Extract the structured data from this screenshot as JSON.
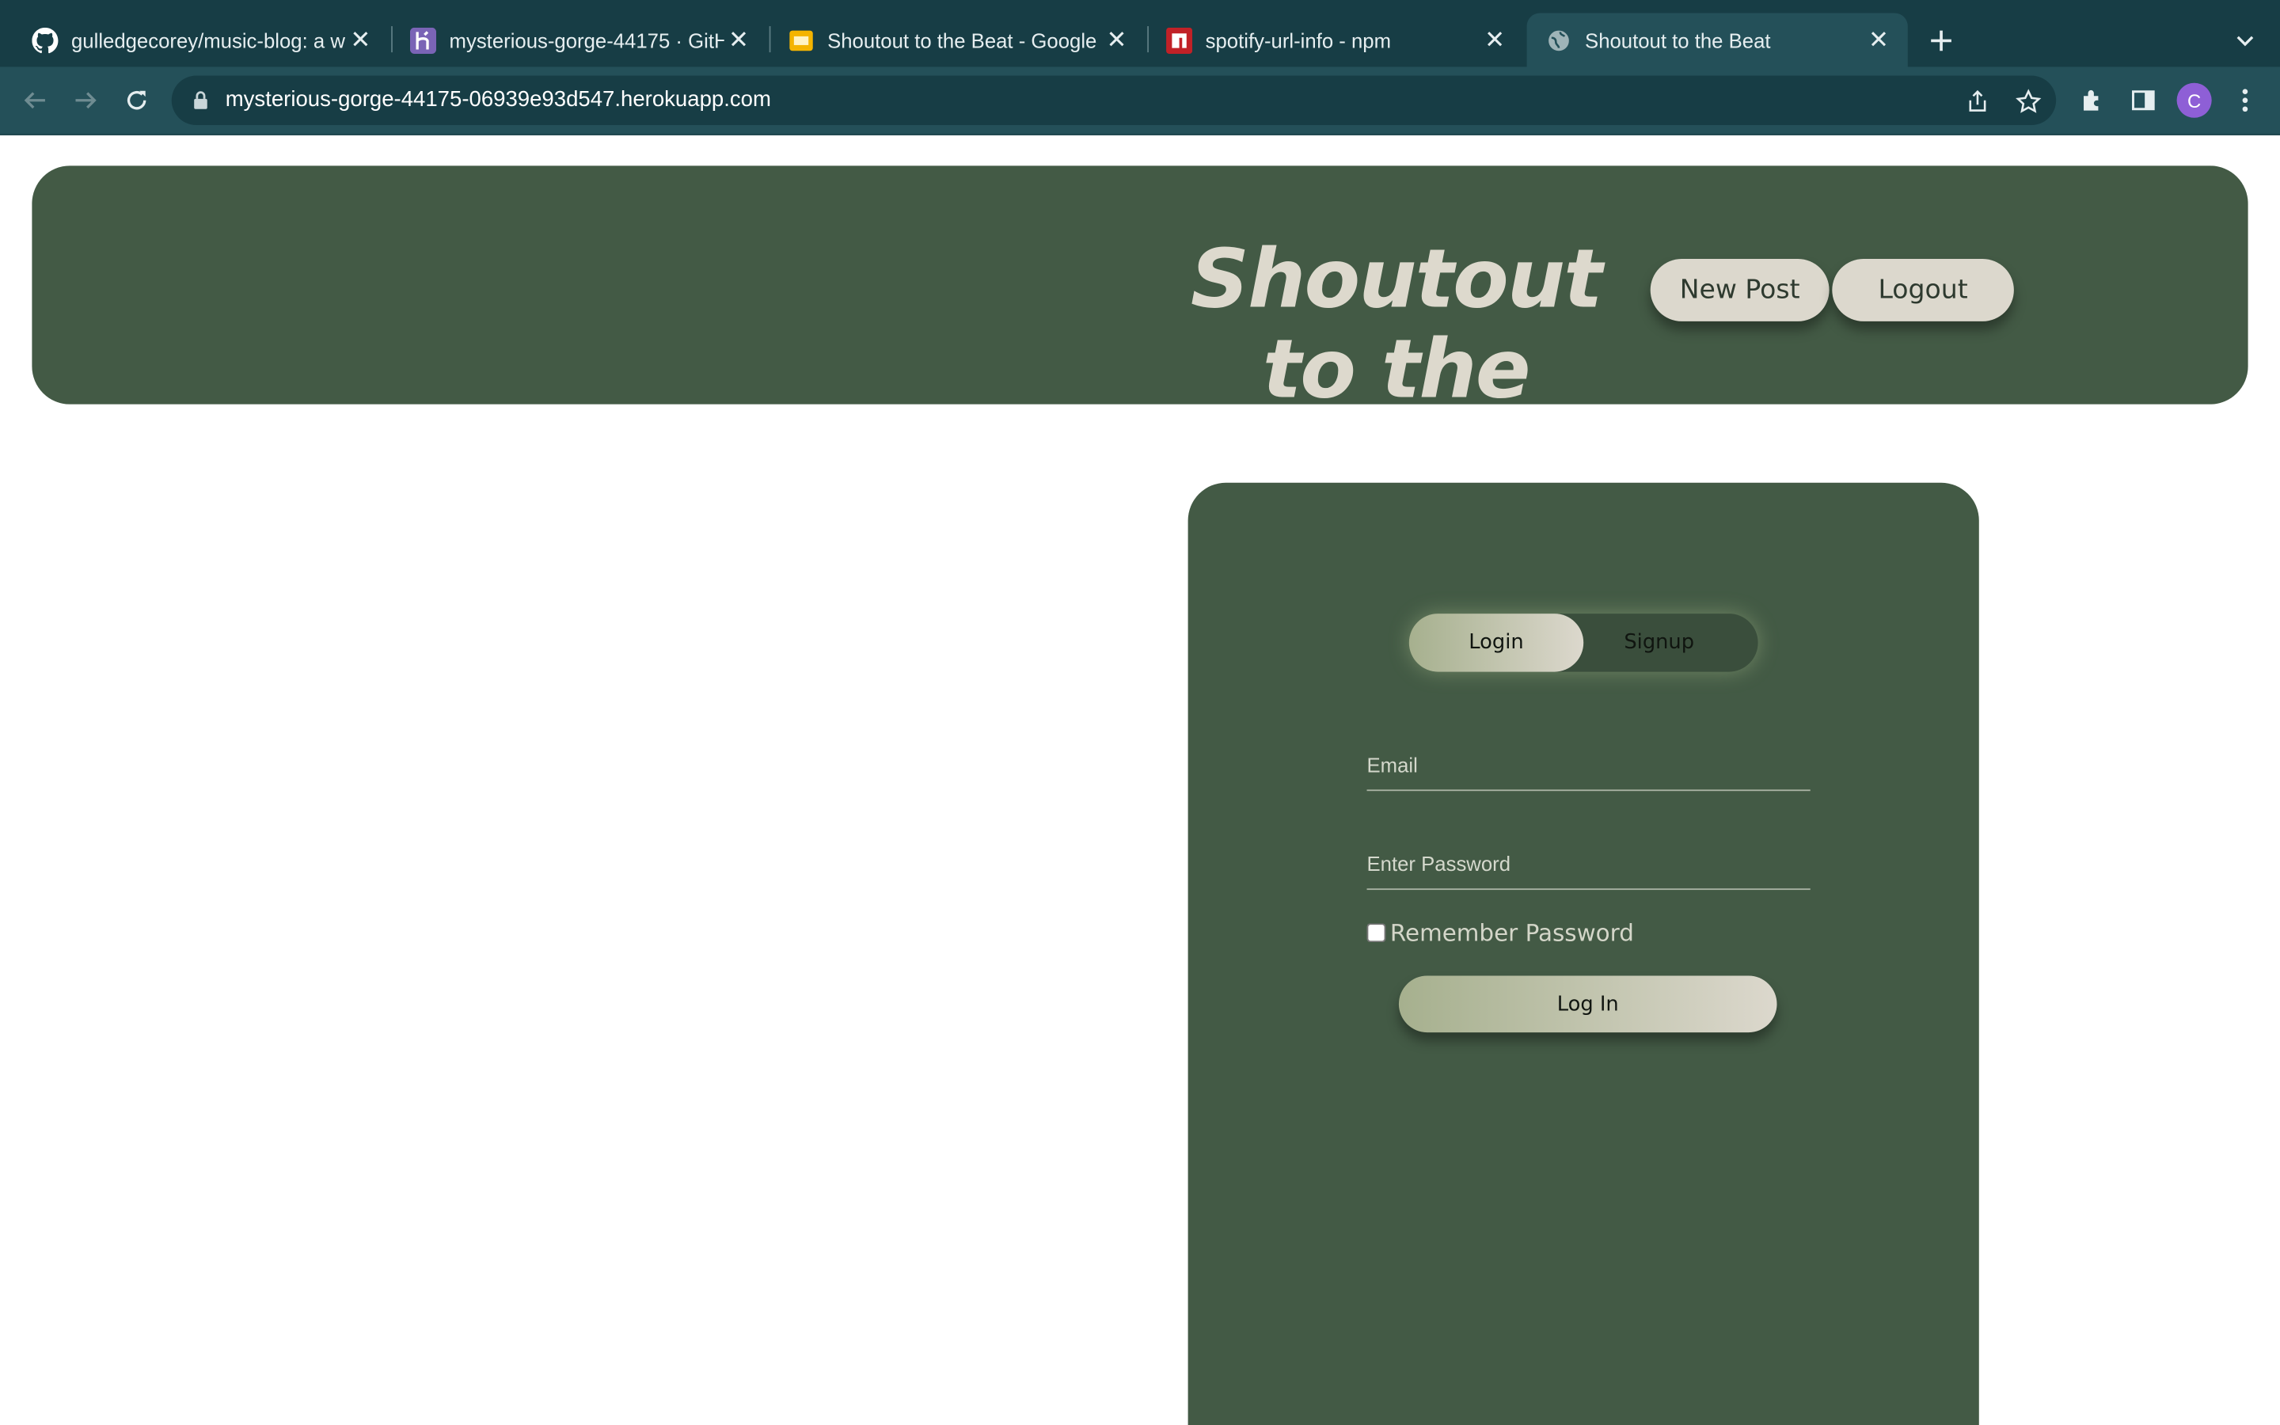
{
  "browser": {
    "tabs": [
      {
        "title": "gulledgecorey/music-blog: a w",
        "favicon": "github-icon"
      },
      {
        "title": "mysterious-gorge-44175 · GitH",
        "favicon": "heroku-icon"
      },
      {
        "title": "Shoutout to the Beat - Google S",
        "favicon": "slides-icon"
      },
      {
        "title": "spotify-url-info - npm",
        "favicon": "npm-icon"
      },
      {
        "title": "Shoutout to the Beat",
        "favicon": "globe-icon",
        "active": true
      }
    ],
    "url": "mysterious-gorge-44175-06939e93d547.herokuapp.com",
    "profile_initial": "C"
  },
  "site": {
    "title": "Shoutout to the Beat",
    "nav": {
      "new_post": "New Post",
      "logout": "Logout"
    }
  },
  "auth": {
    "toggle": {
      "login": "Login",
      "signup": "Signup",
      "selected": "Login"
    },
    "email_placeholder": "Email",
    "password_placeholder": "Enter Password",
    "remember_label": "Remember Password",
    "remember_checked": false,
    "submit_label": "Log In"
  },
  "colors": {
    "chrome_dark": "#173d45",
    "chrome_toolbar": "#245059",
    "brand_green": "#435a45",
    "cream": "#dcd8cd",
    "sage": "#a6b08e"
  }
}
